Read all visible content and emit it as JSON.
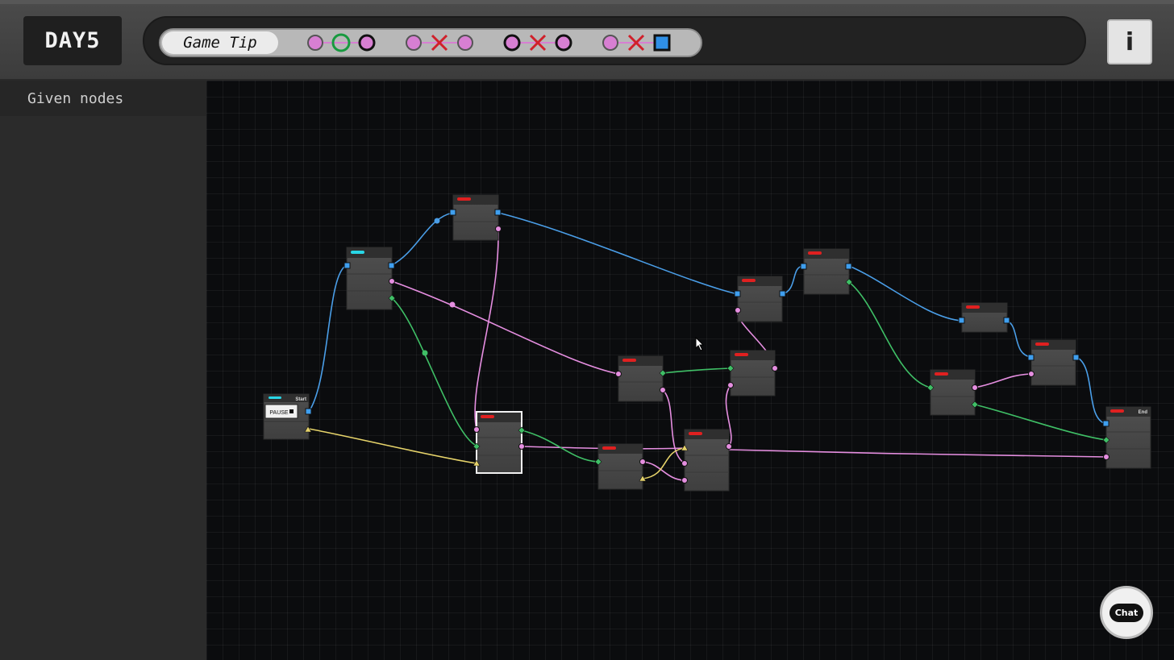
{
  "header": {
    "day_label": "DAY5",
    "game_tip_label": "Game Tip",
    "info_label": "i"
  },
  "tip_rules": [
    {
      "left": "pink-circle",
      "middle": "green-ring",
      "right": "black-ring"
    },
    {
      "left": "pink-circle",
      "middle": "red-x",
      "right": "pink-circle"
    },
    {
      "left": "black-ring",
      "middle": "red-x",
      "right": "black-ring"
    },
    {
      "left": "pink-circle",
      "middle": "red-x",
      "right": "blue-square"
    }
  ],
  "sidebar": {
    "header": "Given nodes"
  },
  "graph": {
    "start_node": {
      "title": "Start",
      "pause_label": "PAUSE"
    },
    "end_node": {
      "title": "End"
    }
  },
  "chat": {
    "label": "Chat"
  },
  "colors": {
    "blue_wire": "#4a9ee8",
    "pink_wire": "#e58ee0",
    "green_wire": "#3fbf66",
    "yellow_wire": "#e6d36a",
    "node_body": "#4b4b4b",
    "node_header": "#2f2f2f",
    "red_tag": "#e02020",
    "cyan_tag": "#28d6e6"
  }
}
